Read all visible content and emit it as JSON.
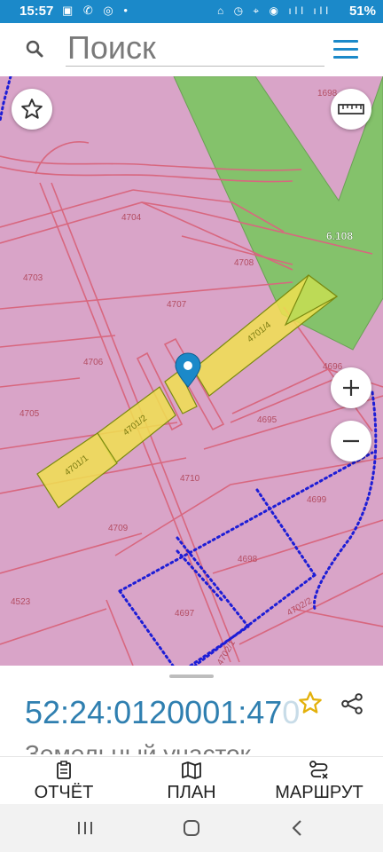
{
  "status_bar": {
    "time": "15:57",
    "left_icons": "▣ ✆ ◎ •",
    "right_icons": "⌂ ◷ ⌖ ◉ ıll ıll",
    "battery": "51%"
  },
  "search": {
    "placeholder": "Поиск"
  },
  "map": {
    "parcels": [
      "1698",
      "4704",
      "4703",
      "4708",
      "4707",
      "4706",
      "4701/4",
      "4705",
      "4701/2",
      "4701/1",
      "4695",
      "4696",
      "4699",
      "4710",
      "4709",
      "4698",
      "4523",
      "4697",
      "4702/2",
      "4702/1"
    ],
    "zone_label": "6.108"
  },
  "sheet": {
    "cadastral_number": "52:24:0120001:47",
    "cadastral_number_faded": "0",
    "subtitle": "Земельный участок"
  },
  "tabs": [
    {
      "label": "ОТЧЁТ",
      "icon": "report-icon"
    },
    {
      "label": "ПЛАН",
      "icon": "map-icon"
    },
    {
      "label": "МАРШРУТ",
      "icon": "route-icon"
    }
  ],
  "colors": {
    "accent": "#1b89c9",
    "cadastral_text": "#2f7fb0",
    "map_pink": "#d9a4c8",
    "zone_green": "#84c26b",
    "selected_yellow": "#f0e050",
    "boundary_blue": "#1d1dd6",
    "star": "#f1c40f"
  }
}
